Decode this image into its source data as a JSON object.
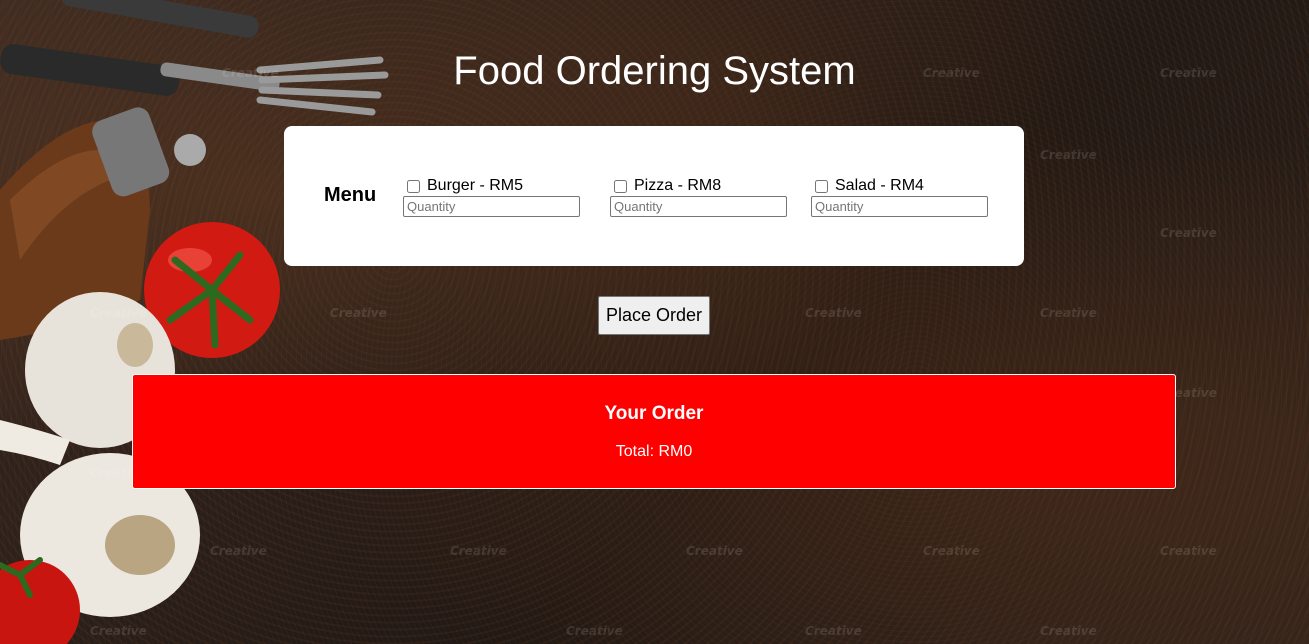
{
  "page": {
    "title": "Food Ordering System"
  },
  "menu": {
    "label": "Menu",
    "items": [
      {
        "label": "Burger - RM5",
        "checked": false,
        "quantity_placeholder": "Quantity",
        "quantity_value": ""
      },
      {
        "label": "Pizza - RM8",
        "checked": false,
        "quantity_placeholder": "Quantity",
        "quantity_value": ""
      },
      {
        "label": "Salad - RM4",
        "checked": false,
        "quantity_placeholder": "Quantity",
        "quantity_value": ""
      }
    ]
  },
  "actions": {
    "place_order_label": "Place Order"
  },
  "order": {
    "title": "Your Order",
    "total_text": "Total: RM0"
  },
  "watermark": {
    "text": "Creative"
  },
  "colors": {
    "order_panel": "#ff0000",
    "card_background": "#ffffff"
  }
}
